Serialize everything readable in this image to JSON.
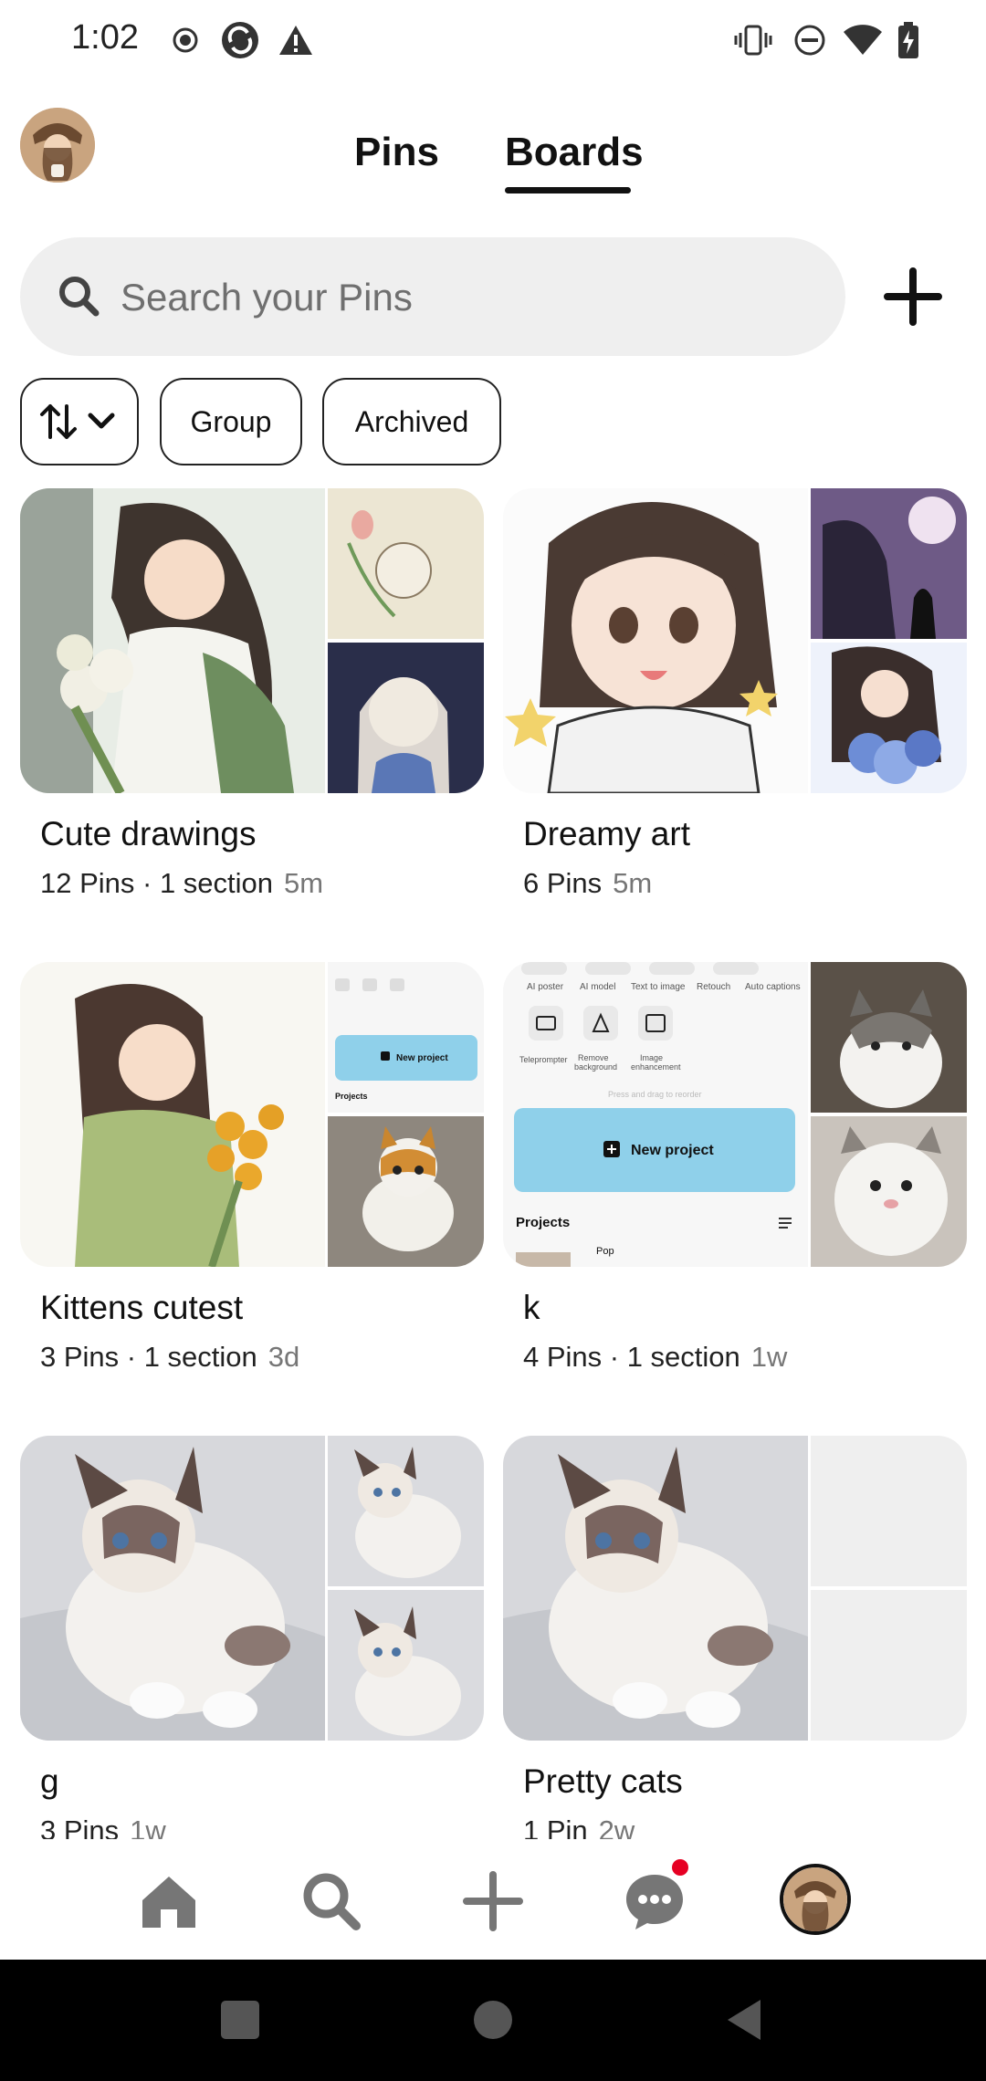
{
  "status_bar": {
    "time": "1:02",
    "left_icons": [
      "record-icon",
      "sync-icon",
      "warning-icon"
    ],
    "right_icons": [
      "vibrate-icon",
      "do-not-disturb-icon",
      "wifi-icon",
      "battery-charging-icon"
    ]
  },
  "header": {
    "tabs": [
      {
        "label": "Pins",
        "selected": false
      },
      {
        "label": "Boards",
        "selected": true
      }
    ]
  },
  "search": {
    "placeholder": "Search your Pins"
  },
  "filters": {
    "sort_icon": "sort-arrows-icon",
    "group_label": "Group",
    "archived_label": "Archived"
  },
  "boards": [
    {
      "title": "Cute drawings",
      "meta": "12 Pins · 1 section",
      "time": "5m"
    },
    {
      "title": "Dreamy art",
      "meta": "6 Pins",
      "time": "5m"
    },
    {
      "title": "Kittens cutest",
      "meta": "3 Pins · 1 section",
      "time": "3d"
    },
    {
      "title": "k",
      "meta": "4 Pins · 1 section",
      "time": "1w"
    },
    {
      "title": "g",
      "meta": "3 Pins",
      "time": "1w"
    },
    {
      "title": "Pretty cats",
      "meta": "1 Pin",
      "time": "2w"
    }
  ],
  "preview_snippets": {
    "new_project": "New project",
    "projects": "Projects",
    "pop": "Pop",
    "ai_poster": "AI poster",
    "ai_model": "AI model",
    "text_to_image": "Text to image",
    "retouch": "Retouch",
    "auto_captions": "Auto captions",
    "teleprompter": "Teleprompter",
    "remove_background": "Remove background",
    "image_enhancement": "Image enhancement",
    "press_and_drag": "Press and drag to reorder"
  },
  "bottom_nav": {
    "items": [
      "home-icon",
      "search-icon",
      "create-icon",
      "messages-icon",
      "profile-avatar"
    ],
    "messages_badge_color": "#e60023"
  },
  "colors": {
    "background": "#ffffff",
    "search_bg": "#efefef",
    "text_primary": "#111111",
    "text_secondary": "#767676",
    "badge": "#e60023"
  }
}
